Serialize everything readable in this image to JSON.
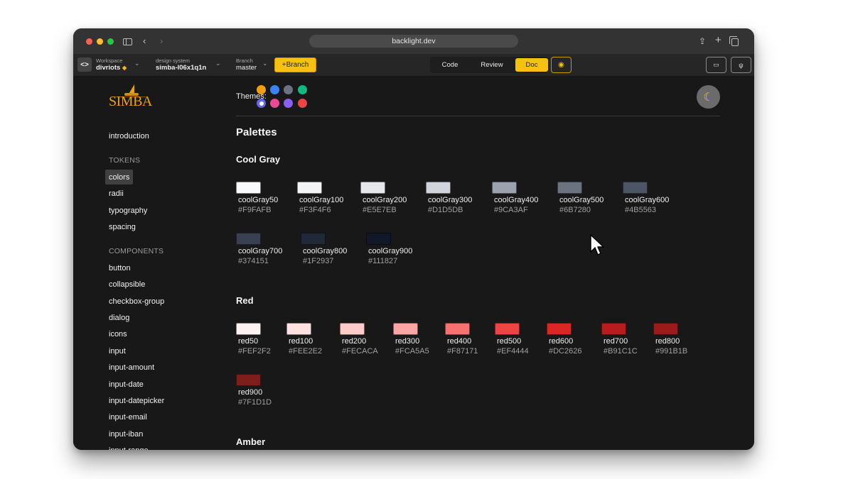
{
  "browser": {
    "url": "backlight.dev",
    "icons": [
      "sidebar-toggle-icon",
      "back-icon",
      "forward-icon",
      "share-icon",
      "new-tab-icon",
      "tab-overview-icon"
    ]
  },
  "appbar": {
    "workspace": {
      "label": "Workspace",
      "value": "divriots"
    },
    "design_system": {
      "label": "design system",
      "value": "simba-l06x1q1n"
    },
    "branch": {
      "label": "Branch",
      "value": "master"
    },
    "branch_button": "+Branch",
    "modes": [
      {
        "label": "Code",
        "active": false
      },
      {
        "label": "Review",
        "active": false
      },
      {
        "label": "Doc",
        "active": true
      }
    ],
    "accent": "#F5C211"
  },
  "sidebar": {
    "logo_text": "SIMBA",
    "top_items": [
      {
        "label": "introduction"
      }
    ],
    "groups": [
      {
        "title": "TOKENS",
        "items": [
          {
            "label": "colors",
            "active": true
          },
          {
            "label": "radii"
          },
          {
            "label": "typography"
          },
          {
            "label": "spacing"
          }
        ]
      },
      {
        "title": "COMPONENTS",
        "items": [
          {
            "label": "button"
          },
          {
            "label": "collapsible"
          },
          {
            "label": "checkbox-group"
          },
          {
            "label": "dialog"
          },
          {
            "label": "icons"
          },
          {
            "label": "input"
          },
          {
            "label": "input-amount"
          },
          {
            "label": "input-date"
          },
          {
            "label": "input-datepicker"
          },
          {
            "label": "input-email"
          },
          {
            "label": "input-iban"
          },
          {
            "label": "input-range"
          }
        ]
      }
    ]
  },
  "main": {
    "themes_label": "Themes:",
    "themes": [
      {
        "color": "#F59E0B"
      },
      {
        "color": "#3B82F6"
      },
      {
        "color": "#6B7280"
      },
      {
        "color": "#10B981"
      },
      {
        "color": "#6366F1",
        "selected": true
      },
      {
        "color": "#EC4899"
      },
      {
        "color": "#8B5CF6"
      },
      {
        "color": "#EF4444"
      }
    ],
    "heading": "Palettes",
    "palettes": [
      {
        "title": "Cool Gray",
        "colors": [
          {
            "name": "coolGray50",
            "hex": "#F9FAFB"
          },
          {
            "name": "coolGray100",
            "hex": "#F3F4F6"
          },
          {
            "name": "coolGray200",
            "hex": "#E5E7EB"
          },
          {
            "name": "coolGray300",
            "hex": "#D1D5DB"
          },
          {
            "name": "coolGray400",
            "hex": "#9CA3AF"
          },
          {
            "name": "coolGray500",
            "hex": "#6B7280"
          },
          {
            "name": "coolGray600",
            "hex": "#4B5563"
          },
          {
            "name": "coolGray700",
            "hex": "#374151"
          },
          {
            "name": "coolGray800",
            "hex": "#1F2937"
          },
          {
            "name": "coolGray900",
            "hex": "#111827"
          }
        ]
      },
      {
        "title": "Red",
        "colors": [
          {
            "name": "red50",
            "hex": "#FEF2F2"
          },
          {
            "name": "red100",
            "hex": "#FEE2E2"
          },
          {
            "name": "red200",
            "hex": "#FECACA"
          },
          {
            "name": "red300",
            "hex": "#FCA5A5"
          },
          {
            "name": "red400",
            "hex": "#F87171"
          },
          {
            "name": "red500",
            "hex": "#EF4444"
          },
          {
            "name": "red600",
            "hex": "#DC2626"
          },
          {
            "name": "red700",
            "hex": "#B91C1C"
          },
          {
            "name": "red800",
            "hex": "#991B1B"
          },
          {
            "name": "red900",
            "hex": "#7F1D1D"
          }
        ]
      },
      {
        "title": "Amber",
        "colors": []
      }
    ]
  }
}
